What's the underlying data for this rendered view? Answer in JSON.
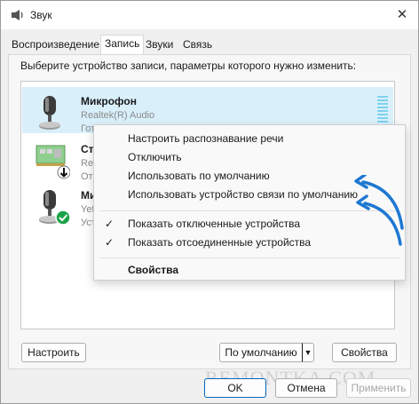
{
  "window": {
    "title": "Звук",
    "close_glyph": "✕"
  },
  "tabs": [
    {
      "label": "Воспроизведение",
      "active": false
    },
    {
      "label": "Запись",
      "active": true
    },
    {
      "label": "Звуки",
      "active": false
    },
    {
      "label": "Связь",
      "active": false
    }
  ],
  "instruction": "Выберите устройство записи, параметры которого нужно изменить:",
  "devices": [
    {
      "name": "Микрофон",
      "line1": "Realtek(R) Audio",
      "line2": "Готов",
      "icon": "microphone-icon",
      "selected": true
    },
    {
      "name": "Сте",
      "line1": "Rea",
      "line2": "Отк",
      "icon": "sound-card-icon",
      "badge": "down-arrow-badge",
      "selected": false
    },
    {
      "name": "Ми",
      "line1": "Yeti",
      "line2": "Уст",
      "icon": "microphone-icon",
      "badge": "default-check-badge",
      "selected": false
    }
  ],
  "context_menu": {
    "items": [
      {
        "label": "Настроить распознавание речи",
        "checked": false,
        "bold": false
      },
      {
        "label": "Отключить",
        "checked": false,
        "bold": false
      },
      {
        "label": "Использовать по умолчанию",
        "checked": false,
        "bold": false
      },
      {
        "label": "Использовать устройство связи по умолчанию",
        "checked": false,
        "bold": false
      },
      {
        "label": "Показать отключенные устройства",
        "checked": true,
        "bold": false
      },
      {
        "label": "Показать отсоединенные устройства",
        "checked": true,
        "bold": false
      },
      {
        "label": "Свойства",
        "checked": false,
        "bold": true
      }
    ],
    "check_glyph": "✓"
  },
  "buttons": {
    "configure": "Настроить",
    "default": "По умолчанию",
    "default_arrow": "▼",
    "properties": "Свойства",
    "ok": "OK",
    "cancel": "Отмена",
    "apply": "Применить"
  },
  "watermark": "REMONTKA.COM",
  "colors": {
    "selection": "#d9f0fb",
    "accent_blue": "#0067c0",
    "annotation_arrow": "#1e78d2",
    "default_badge": "#1aa34a"
  }
}
